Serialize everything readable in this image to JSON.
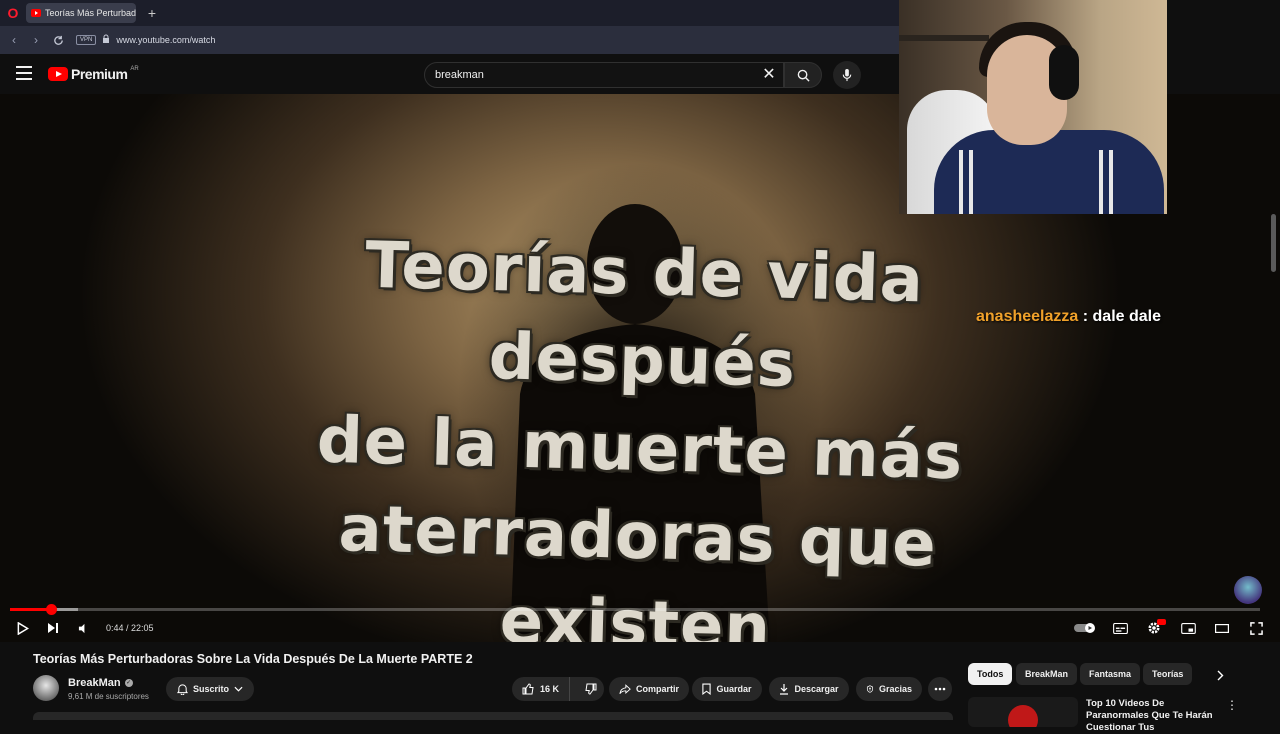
{
  "browser": {
    "tab_title": "Teorías Más Perturbadoras",
    "new_tab_label": "+",
    "vpn_label": "VPN",
    "url": "www.youtube.com/watch"
  },
  "header": {
    "logo_text": "Premium",
    "country_code": "AR",
    "search_value": "breakman"
  },
  "video": {
    "overlay_lines": [
      "Teorías de vida después",
      "de la muerte más",
      "aterradoras que existen"
    ],
    "current_time": "0:44",
    "duration": "22:05",
    "time_display": "0:44 / 22:05",
    "progress_fraction": 0.033,
    "buffered_fraction": 0.054
  },
  "chat": {
    "username": "anasheelazza",
    "separator": ":",
    "message": "dale dale"
  },
  "details": {
    "title": "Teorías Más Perturbadoras Sobre La Vida Después De La Muerte PARTE 2",
    "channel_name": "BreakMan",
    "subscribers": "9,61 M de suscriptores",
    "subscribed_label": "Suscrito",
    "like_count": "16 K",
    "share_label": "Compartir",
    "save_label": "Guardar",
    "download_label": "Descargar",
    "thanks_label": "Gracias"
  },
  "chips": [
    "Todos",
    "BreakMan",
    "Fantasma",
    "Teorías"
  ],
  "recommendation": {
    "title": "Top 10 Videos De Paranormales Que Te Harán Cuestionar Tus"
  },
  "colors": {
    "accent_red": "#ff0000",
    "chat_user": "#f0a12a",
    "background": "#0f0f0f"
  }
}
